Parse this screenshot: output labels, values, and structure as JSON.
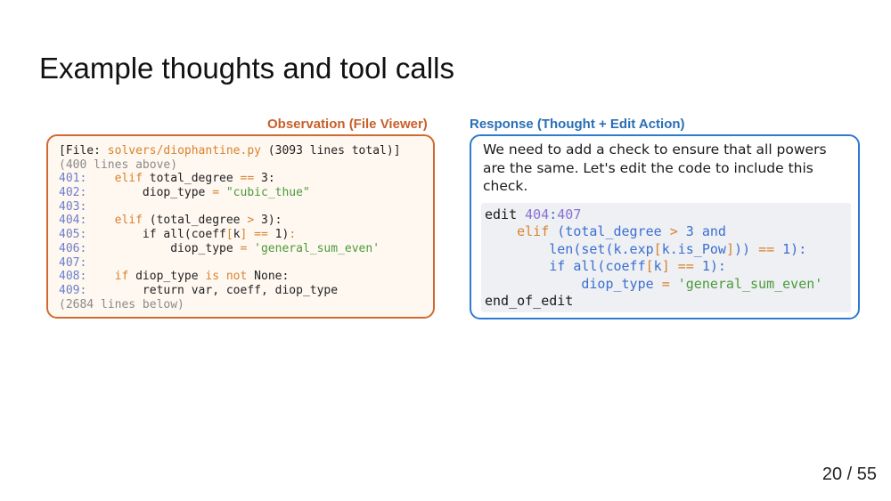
{
  "slide": {
    "title": "Example thoughts and tool calls",
    "page_number": "20 / 55"
  },
  "observation": {
    "caption": "Observation (File Viewer)",
    "file_prefix": "[File: ",
    "file_path": "solvers/diophantine.py",
    "file_suffix": " (3093 lines total)]",
    "lines_above": "(400 lines above)",
    "lines": [
      {
        "num": "401:",
        "segments": [
          {
            "t": "    ",
            "c": ""
          },
          {
            "t": "elif",
            "c": "kw"
          },
          {
            "t": " total_degree ",
            "c": ""
          },
          {
            "t": "==",
            "c": "kw"
          },
          {
            "t": " 3:",
            "c": ""
          }
        ]
      },
      {
        "num": "402:",
        "segments": [
          {
            "t": "        diop_type ",
            "c": ""
          },
          {
            "t": "=",
            "c": "kw"
          },
          {
            "t": " ",
            "c": ""
          },
          {
            "t": "\"cubic_thue\"",
            "c": "str"
          }
        ]
      },
      {
        "num": "403:",
        "segments": []
      },
      {
        "num": "404:",
        "segments": [
          {
            "t": "    ",
            "c": ""
          },
          {
            "t": "elif",
            "c": "kw"
          },
          {
            "t": " (total_degree ",
            "c": ""
          },
          {
            "t": ">",
            "c": "kw"
          },
          {
            "t": " 3):",
            "c": ""
          }
        ]
      },
      {
        "num": "405:",
        "segments": [
          {
            "t": "        if all(coeff",
            "c": ""
          },
          {
            "t": "[",
            "c": "kw"
          },
          {
            "t": "k",
            "c": ""
          },
          {
            "t": "]",
            "c": "kw"
          },
          {
            "t": " ",
            "c": ""
          },
          {
            "t": "==",
            "c": "kw"
          },
          {
            "t": " 1)",
            "c": ""
          },
          {
            "t": ":",
            "c": "kw"
          }
        ]
      },
      {
        "num": "406:",
        "segments": [
          {
            "t": "            diop_type ",
            "c": ""
          },
          {
            "t": "=",
            "c": "kw"
          },
          {
            "t": " ",
            "c": ""
          },
          {
            "t": "'general_sum_even'",
            "c": "str"
          }
        ]
      },
      {
        "num": "407:",
        "segments": []
      },
      {
        "num": "408:",
        "segments": [
          {
            "t": "    ",
            "c": ""
          },
          {
            "t": "if",
            "c": "kw"
          },
          {
            "t": " diop_type ",
            "c": ""
          },
          {
            "t": "is not",
            "c": "kw"
          },
          {
            "t": " None:",
            "c": ""
          }
        ]
      },
      {
        "num": "409:",
        "segments": [
          {
            "t": "        return var, coeff, diop_type",
            "c": ""
          }
        ]
      }
    ],
    "lines_below": "(2684 lines below)"
  },
  "response": {
    "caption": "Response (Thought + Edit Action)",
    "thought": "We need to add a check to ensure that all powers are the same. Let's edit the code to include this check.",
    "edit_lines": [
      [
        {
          "t": "edit ",
          "c": ""
        },
        {
          "t": "404",
          "c": "num"
        },
        {
          "t": ":",
          "c": "var"
        },
        {
          "t": "407",
          "c": "num"
        }
      ],
      [
        {
          "t": "    ",
          "c": ""
        },
        {
          "t": "elif",
          "c": "kw"
        },
        {
          "t": " (total_degree ",
          "c": "var"
        },
        {
          "t": ">",
          "c": "kw"
        },
        {
          "t": " 3 and",
          "c": "var"
        }
      ],
      [
        {
          "t": "        len(set(k.exp",
          "c": "var"
        },
        {
          "t": "[",
          "c": "kw"
        },
        {
          "t": "k.is_Pow",
          "c": "var"
        },
        {
          "t": "]",
          "c": "kw"
        },
        {
          "t": ")) ",
          "c": "var"
        },
        {
          "t": "==",
          "c": "kw"
        },
        {
          "t": " 1):",
          "c": "var"
        }
      ],
      [
        {
          "t": "        if all(coeff",
          "c": "var"
        },
        {
          "t": "[",
          "c": "kw"
        },
        {
          "t": "k",
          "c": "var"
        },
        {
          "t": "]",
          "c": "kw"
        },
        {
          "t": " ",
          "c": ""
        },
        {
          "t": "==",
          "c": "kw"
        },
        {
          "t": " 1):",
          "c": "var"
        }
      ],
      [
        {
          "t": "            diop_type ",
          "c": "var"
        },
        {
          "t": "=",
          "c": "kw"
        },
        {
          "t": " ",
          "c": ""
        },
        {
          "t": "'general_sum_even'",
          "c": "str"
        }
      ],
      [
        {
          "t": "end_of_edit",
          "c": ""
        }
      ]
    ]
  },
  "colors": {
    "observation_accent": "#d06a32",
    "response_accent": "#2f7ad0",
    "keyword": "#d8822e",
    "string": "#4a9a3a",
    "line_number": "#6b7fc9"
  }
}
